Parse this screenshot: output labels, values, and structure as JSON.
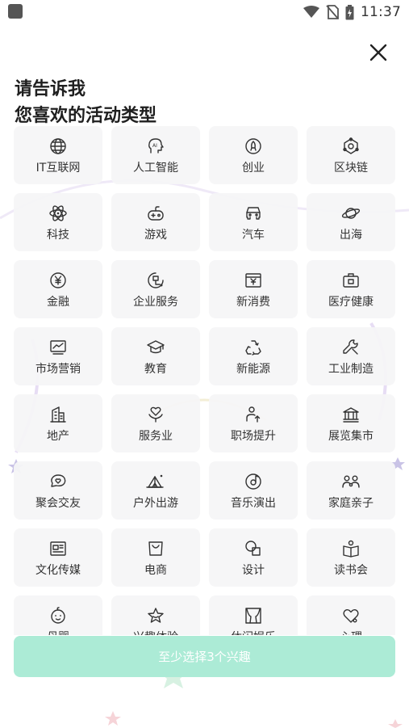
{
  "status_bar": {
    "time": "11:37",
    "icons": [
      "app-notification-icon",
      "wifi-icon",
      "no-sim-icon",
      "battery-charging-icon"
    ]
  },
  "header": {
    "close_icon": "close-icon",
    "title_line1": "请告诉我",
    "title_line2": "您喜欢的活动类型"
  },
  "categories": [
    {
      "label": "IT互联网",
      "icon": "globe-icon"
    },
    {
      "label": "人工智能",
      "icon": "ai-head-icon"
    },
    {
      "label": "创业",
      "icon": "rocket-icon"
    },
    {
      "label": "区块链",
      "icon": "blockchain-icon"
    },
    {
      "label": "科技",
      "icon": "atom-icon"
    },
    {
      "label": "游戏",
      "icon": "gamepad-icon"
    },
    {
      "label": "汽车",
      "icon": "car-icon"
    },
    {
      "label": "出海",
      "icon": "planet-icon"
    },
    {
      "label": "金融",
      "icon": "yen-coin-icon"
    },
    {
      "label": "企业服务",
      "icon": "enterprise-icon"
    },
    {
      "label": "新消费",
      "icon": "receipt-icon"
    },
    {
      "label": "医疗健康",
      "icon": "medical-kit-icon"
    },
    {
      "label": "市场营销",
      "icon": "line-chart-icon"
    },
    {
      "label": "教育",
      "icon": "graduation-cap-icon"
    },
    {
      "label": "新能源",
      "icon": "recycle-icon"
    },
    {
      "label": "工业制造",
      "icon": "wrench-icon"
    },
    {
      "label": "地产",
      "icon": "building-icon"
    },
    {
      "label": "服务业",
      "icon": "heart-hand-icon"
    },
    {
      "label": "职场提升",
      "icon": "person-up-icon"
    },
    {
      "label": "展览集市",
      "icon": "museum-icon"
    },
    {
      "label": "聚会交友",
      "icon": "chat-heart-icon"
    },
    {
      "label": "户外出游",
      "icon": "tent-icon"
    },
    {
      "label": "音乐演出",
      "icon": "music-disc-icon"
    },
    {
      "label": "家庭亲子",
      "icon": "family-icon"
    },
    {
      "label": "文化传媒",
      "icon": "newspaper-icon"
    },
    {
      "label": "电商",
      "icon": "shopping-bag-icon"
    },
    {
      "label": "设计",
      "icon": "shapes-icon"
    },
    {
      "label": "读书会",
      "icon": "book-person-icon"
    },
    {
      "label": "母婴",
      "icon": "baby-face-icon"
    },
    {
      "label": "兴趣体验",
      "icon": "star-icon"
    },
    {
      "label": "休闲娱乐",
      "icon": "stage-curtain-icon"
    },
    {
      "label": "心理",
      "icon": "heart-icon"
    }
  ],
  "confirm_button": {
    "label": "至少选择3个兴趣",
    "color": "#acebd6"
  }
}
